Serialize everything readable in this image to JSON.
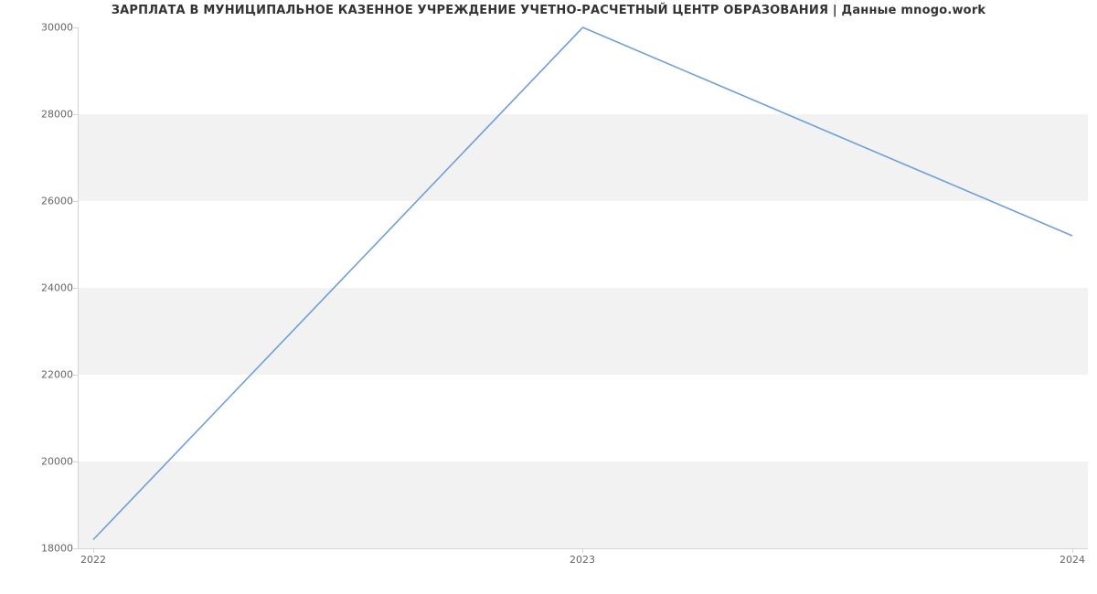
{
  "chart_data": {
    "type": "line",
    "title": "ЗАРПЛАТА В МУНИЦИПАЛЬНОЕ КАЗЕННОЕ УЧРЕЖДЕНИЕ УЧЕТНО-РАСЧЕТНЫЙ ЦЕНТР ОБРАЗОВАНИЯ | Данные mnogo.work",
    "x": [
      2022,
      2023,
      2024
    ],
    "values": [
      18200,
      30000,
      25200
    ],
    "x_ticks": [
      2022,
      2023,
      2024
    ],
    "y_ticks": [
      18000,
      20000,
      22000,
      24000,
      26000,
      28000,
      30000
    ],
    "xlim": [
      2022,
      2024
    ],
    "ylim": [
      18000,
      30000
    ],
    "xlabel": "",
    "ylabel": "",
    "line_color": "#6f9fd8",
    "band_color": "#f2f2f2"
  }
}
